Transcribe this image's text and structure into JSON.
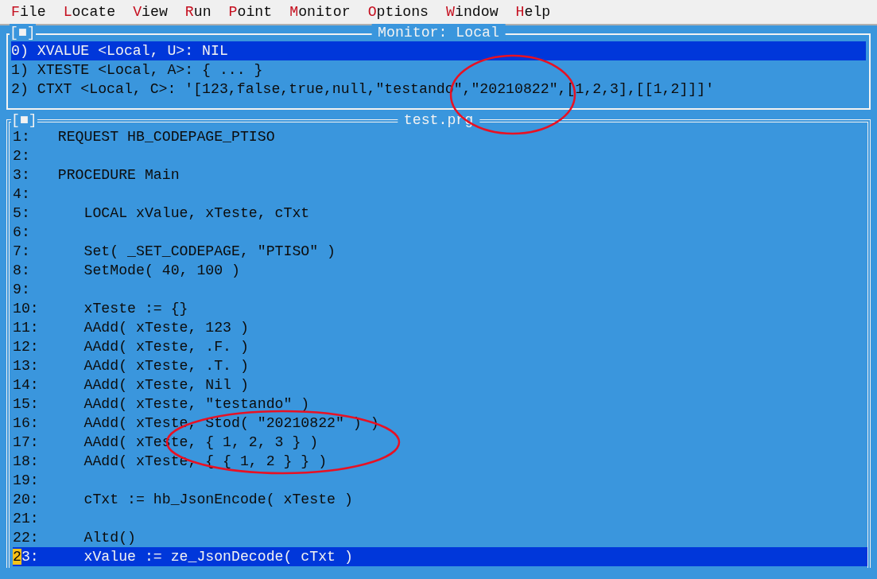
{
  "menu": [
    {
      "hotkey": "F",
      "rest": "ile"
    },
    {
      "hotkey": "L",
      "rest": "ocate"
    },
    {
      "hotkey": "V",
      "rest": "iew"
    },
    {
      "hotkey": "R",
      "rest": "un"
    },
    {
      "hotkey": "P",
      "rest": "oint"
    },
    {
      "hotkey": "M",
      "rest": "onitor"
    },
    {
      "hotkey": "O",
      "rest": "ptions"
    },
    {
      "hotkey": "W",
      "rest": "indow"
    },
    {
      "hotkey": "H",
      "rest": "elp"
    }
  ],
  "monitor": {
    "close_box": "[■]",
    "title": "Monitor: Local",
    "items": [
      {
        "text": "0) XVALUE <Local, U>: NIL",
        "selected": true
      },
      {
        "text": "1) XTESTE <Local, A>: { ... }",
        "selected": false
      },
      {
        "text": "2) CTXT <Local, C>: '[123,false,true,null,\"testando\",\"20210822\",[1,2,3],[[1,2]]]'",
        "selected": false
      }
    ]
  },
  "source": {
    "close_box": "[■]",
    "title": "test.prg",
    "lines": [
      {
        "number": "1:",
        "code": "REQUEST HB_CODEPAGE_PTISO",
        "selected": false,
        "cursor": false
      },
      {
        "number": "2:",
        "selected": false,
        "cursor": false
      },
      {
        "number": "3:",
        "code": "PROCEDURE Main",
        "selected": false,
        "cursor": false
      },
      {
        "number": "4:",
        "selected": false,
        "cursor": false
      },
      {
        "number": "5:",
        "code": "   LOCAL xValue, xTeste, cTxt",
        "selected": false,
        "cursor": false
      },
      {
        "number": "6:",
        "selected": false,
        "cursor": false
      },
      {
        "number": "7:",
        "code": "   Set( _SET_CODEPAGE, \"PTISO\" )",
        "selected": false,
        "cursor": false
      },
      {
        "number": "8:",
        "code": "   SetMode( 40, 100 )",
        "selected": false,
        "cursor": false
      },
      {
        "number": "9:",
        "selected": false,
        "cursor": false
      },
      {
        "number": "10:",
        "code": "   xTeste := {}",
        "selected": false,
        "cursor": false
      },
      {
        "number": "11:",
        "code": "   AAdd( xTeste, 123 )",
        "selected": false,
        "cursor": false
      },
      {
        "number": "12:",
        "code": "   AAdd( xTeste, .F. )",
        "selected": false,
        "cursor": false
      },
      {
        "number": "13:",
        "code": "   AAdd( xTeste, .T. )",
        "selected": false,
        "cursor": false
      },
      {
        "number": "14:",
        "code": "   AAdd( xTeste, Nil )",
        "selected": false,
        "cursor": false
      },
      {
        "number": "15:",
        "code": "   AAdd( xTeste, \"testando\" )",
        "selected": false,
        "cursor": false
      },
      {
        "number": "16:",
        "code": "   AAdd( xTeste, Stod( \"20210822\" ) )",
        "selected": false,
        "cursor": false
      },
      {
        "number": "17:",
        "code": "   AAdd( xTeste, { 1, 2, 3 } )",
        "selected": false,
        "cursor": false
      },
      {
        "number": "18:",
        "code": "   AAdd( xTeste, { { 1, 2 } } )",
        "selected": false,
        "cursor": false
      },
      {
        "number": "19:",
        "selected": false,
        "cursor": false
      },
      {
        "number": "20:",
        "code": "   cTxt := hb_JsonEncode( xTeste )",
        "selected": false,
        "cursor": false
      },
      {
        "number": "21:",
        "selected": false,
        "cursor": false
      },
      {
        "number": "22:",
        "code": "   Altd()",
        "selected": false,
        "cursor": false
      },
      {
        "number": "23:",
        "code": "   xValue := ze_JsonDecode( cTxt )",
        "selected": true,
        "cursor": true
      }
    ]
  },
  "annotations": [
    {
      "kind": "ellipse"
    },
    {
      "kind": "ellipse"
    }
  ]
}
